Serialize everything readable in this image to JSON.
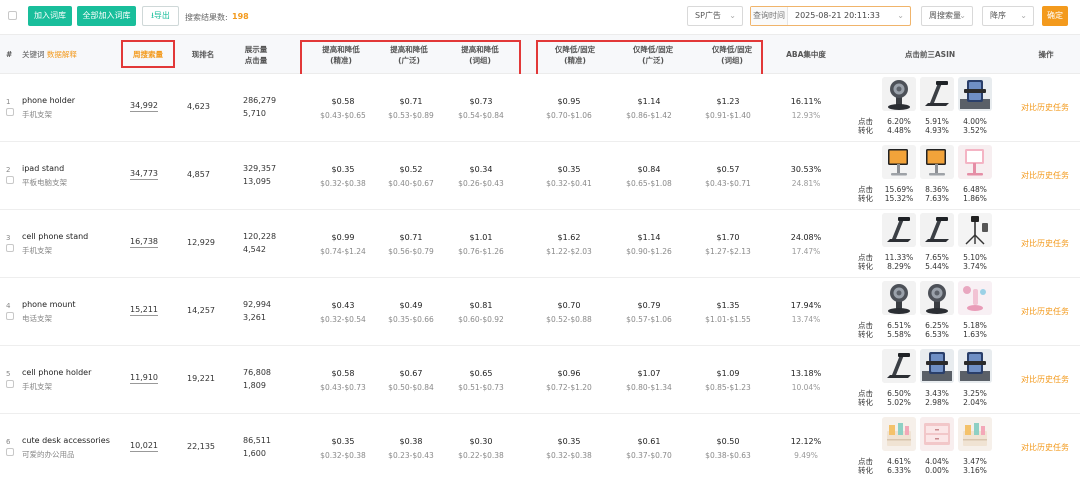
{
  "toolbar": {
    "add_label": "加入词库",
    "add_all_label": "全部加入词库",
    "export_label": "导出",
    "result_label": "搜索结果数:",
    "result_count": "198",
    "ad_type": "SP广告",
    "date_label": "查询时间",
    "date_value": "2025-08-21 20:11:33",
    "metric": "周搜索量",
    "order": "降序",
    "confirm_label": "确定"
  },
  "header": {
    "index": "#",
    "keyword": "关键词",
    "keyword_link": "数据解释",
    "weekly_search": "周搜索量",
    "rank": "现排名",
    "impressions": "展示量",
    "clicks": "点击量",
    "bid_updown_exact": "提高和降低",
    "bid_updown_exact_sub": "(精准)",
    "bid_updown_broad": "提高和降低",
    "bid_updown_broad_sub": "(广泛)",
    "bid_updown_phrase": "提高和降低",
    "bid_updown_phrase_sub": "(词组)",
    "bid_down_exact": "仅降低/固定",
    "bid_down_exact_sub": "(精准)",
    "bid_down_broad": "仅降低/固定",
    "bid_down_broad_sub": "(广泛)",
    "bid_down_phrase": "仅降低/固定",
    "bid_down_phrase_sub": "(词组)",
    "aba": "ABA集中度",
    "top3": "点击前三ASIN",
    "action": "操作"
  },
  "labels": {
    "click": "点击",
    "convert": "转化"
  },
  "rows": [
    {
      "num": "1",
      "kw": "phone holder",
      "kwcn": "手机支架",
      "search": "34,992",
      "rank": "4,623",
      "imp": "286,279",
      "clk": "5,710",
      "b1": "$0.58",
      "b1r": "$0.43-$0.65",
      "b2": "$0.71",
      "b2r": "$0.53-$0.89",
      "b3": "$0.73",
      "b3r": "$0.54-$0.84",
      "b4": "$0.95",
      "b4r": "$0.70-$1.06",
      "b5": "$1.14",
      "b5r": "$0.86-$1.42",
      "b6": "$1.23",
      "b6r": "$0.91-$1.40",
      "aba": "16.11%",
      "aba2": "12.93%",
      "c1": "6.20%",
      "v1": "4.48%",
      "c2": "5.91%",
      "v2": "4.93%",
      "c3": "4.00%",
      "v3": "3.52%",
      "icons": [
        "magnetic-mount-icon",
        "folding-stand-icon",
        "car-vent-holder-icon"
      ],
      "action": "对比历史任务"
    },
    {
      "num": "2",
      "kw": "ipad stand",
      "kwcn": "平板电脑支架",
      "search": "34,773",
      "rank": "4,857",
      "imp": "329,357",
      "clk": "13,095",
      "b1": "$0.35",
      "b1r": "$0.32-$0.38",
      "b2": "$0.52",
      "b2r": "$0.40-$0.67",
      "b3": "$0.34",
      "b3r": "$0.26-$0.43",
      "b4": "$0.35",
      "b4r": "$0.32-$0.41",
      "b5": "$0.84",
      "b5r": "$0.65-$1.08",
      "b6": "$0.57",
      "b6r": "$0.43-$0.71",
      "aba": "30.53%",
      "aba2": "24.81%",
      "c1": "15.69%",
      "v1": "15.32%",
      "c2": "8.36%",
      "v2": "7.63%",
      "c3": "6.48%",
      "v3": "1.86%",
      "icons": [
        "tablet-stand-icon",
        "tablet-stand-icon",
        "pink-stand-icon"
      ],
      "action": "对比历史任务"
    },
    {
      "num": "3",
      "kw": "cell phone stand",
      "kwcn": "手机支架",
      "search": "16,738",
      "rank": "12,929",
      "imp": "120,228",
      "clk": "4,542",
      "b1": "$0.99",
      "b1r": "$0.74-$1.24",
      "b2": "$0.71",
      "b2r": "$0.56-$0.79",
      "b3": "$1.01",
      "b3r": "$0.76-$1.26",
      "b4": "$1.62",
      "b4r": "$1.22-$2.03",
      "b5": "$1.14",
      "b5r": "$0.90-$1.26",
      "b6": "$1.70",
      "b6r": "$1.27-$2.13",
      "aba": "24.08%",
      "aba2": "17.47%",
      "c1": "11.33%",
      "v1": "8.29%",
      "c2": "7.65%",
      "v2": "5.44%",
      "c3": "5.10%",
      "v3": "3.74%",
      "icons": [
        "folding-stand-icon",
        "folding-stand-icon",
        "tripod-icon"
      ],
      "action": "对比历史任务"
    },
    {
      "num": "4",
      "kw": "phone mount",
      "kwcn": "电话支架",
      "search": "15,211",
      "rank": "14,257",
      "imp": "92,994",
      "clk": "3,261",
      "b1": "$0.43",
      "b1r": "$0.32-$0.54",
      "b2": "$0.49",
      "b2r": "$0.35-$0.66",
      "b3": "$0.81",
      "b3r": "$0.60-$0.92",
      "b4": "$0.70",
      "b4r": "$0.52-$0.88",
      "b5": "$0.79",
      "b5r": "$0.57-$1.06",
      "b6": "$1.35",
      "b6r": "$1.01-$1.55",
      "aba": "17.94%",
      "aba2": "13.74%",
      "c1": "6.51%",
      "v1": "5.58%",
      "c2": "6.25%",
      "v2": "6.53%",
      "c3": "5.18%",
      "v3": "1.63%",
      "icons": [
        "magnetic-mount-icon",
        "magnetic-mount-icon",
        "pink-mount-icon"
      ],
      "action": "对比历史任务"
    },
    {
      "num": "5",
      "kw": "cell phone holder",
      "kwcn": "手机支架",
      "search": "11,910",
      "rank": "19,221",
      "imp": "76,808",
      "clk": "1,809",
      "b1": "$0.58",
      "b1r": "$0.43-$0.73",
      "b2": "$0.67",
      "b2r": "$0.50-$0.84",
      "b3": "$0.65",
      "b3r": "$0.51-$0.73",
      "b4": "$0.96",
      "b4r": "$0.72-$1.20",
      "b5": "$1.07",
      "b5r": "$0.80-$1.34",
      "b6": "$1.09",
      "b6r": "$0.85-$1.23",
      "aba": "13.18%",
      "aba2": "10.04%",
      "c1": "6.50%",
      "v1": "5.02%",
      "c2": "3.43%",
      "v2": "2.98%",
      "c3": "3.25%",
      "v3": "2.04%",
      "icons": [
        "folding-stand-icon",
        "car-vent-holder-icon",
        "car-vent-holder-icon"
      ],
      "action": "对比历史任务"
    },
    {
      "num": "6",
      "kw": "cute desk accessories",
      "kwcn": "可爱的办公用品",
      "search": "10,021",
      "rank": "22,135",
      "imp": "86,511",
      "clk": "1,600",
      "b1": "$0.35",
      "b1r": "$0.32-$0.38",
      "b2": "$0.38",
      "b2r": "$0.23-$0.43",
      "b3": "$0.30",
      "b3r": "$0.22-$0.38",
      "b4": "$0.35",
      "b4r": "$0.32-$0.38",
      "b5": "$0.61",
      "b5r": "$0.37-$0.70",
      "b6": "$0.50",
      "b6r": "$0.38-$0.63",
      "aba": "12.12%",
      "aba2": "9.49%",
      "c1": "4.61%",
      "v1": "6.33%",
      "c2": "4.04%",
      "v2": "0.00%",
      "c3": "3.47%",
      "v3": "3.16%",
      "icons": [
        "desk-organizer-icon",
        "drawer-organizer-icon",
        "desk-organizer-icon"
      ],
      "action": "对比历史任务"
    }
  ]
}
